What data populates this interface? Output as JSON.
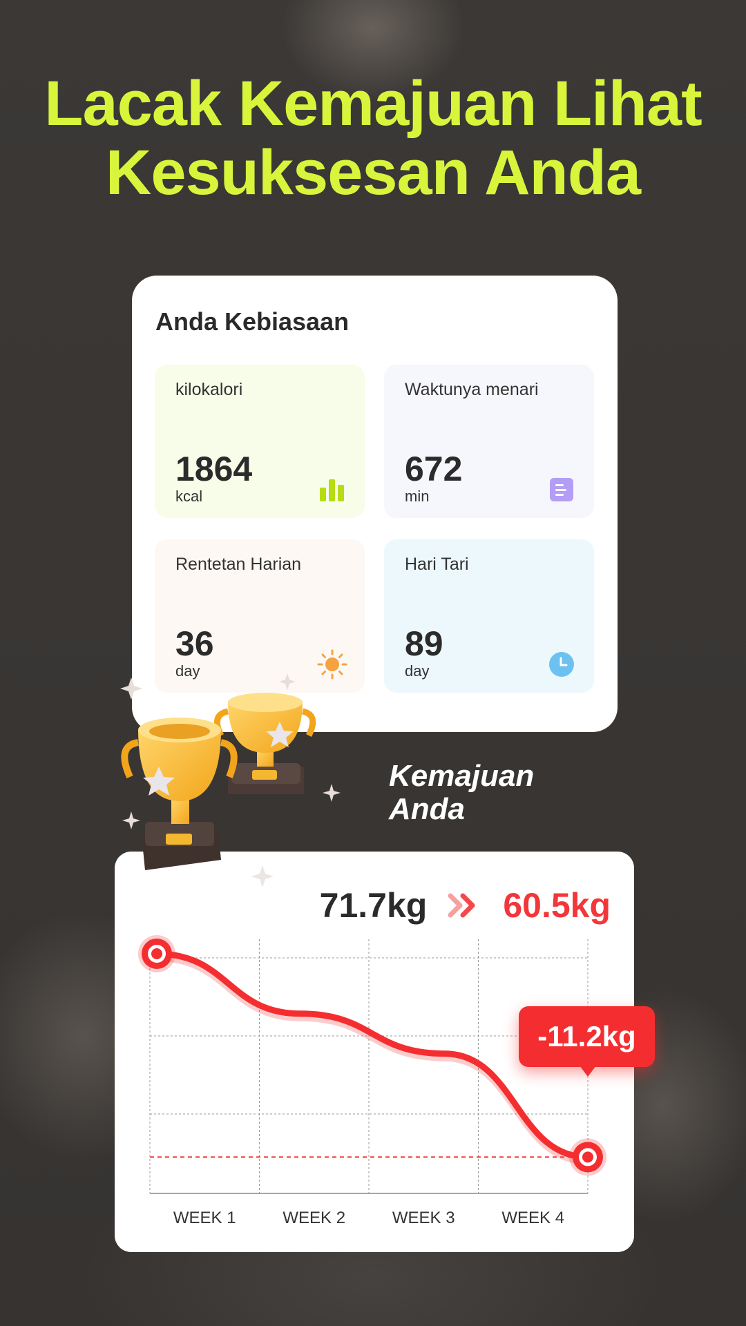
{
  "headline": {
    "line1": "Lacak Kemajuan Lihat",
    "line2": "Kesuksesan Anda"
  },
  "habits": {
    "title": "Anda Kebiasaan",
    "tiles": [
      {
        "label": "kilokalori",
        "value": "1864",
        "unit": "kcal",
        "icon": "bar-chart-icon"
      },
      {
        "label": "Waktunya menari",
        "value": "672",
        "unit": "min",
        "icon": "document-icon"
      },
      {
        "label": "Rentetan Harian",
        "value": "36",
        "unit": "day",
        "icon": "sun-icon"
      },
      {
        "label": "Hari Tari",
        "value": "89",
        "unit": "day",
        "icon": "clock-icon"
      }
    ]
  },
  "progress": {
    "title_line1": "Kemajuan",
    "title_line2": "Anda",
    "start_weight": "71.7kg",
    "end_weight": "60.5kg",
    "difference": "-11.2kg"
  },
  "colors": {
    "accent": "#d8f53b",
    "red": "#f42e30",
    "purple": "#b39df5",
    "orange": "#f5a340",
    "blue": "#6cc1f0"
  },
  "chart_data": {
    "type": "line",
    "categories": [
      "WEEK 1",
      "WEEK 2",
      "WEEK 3",
      "WEEK 4"
    ],
    "series": [
      {
        "values": [
          71.7,
          68.4,
          66.2,
          60.5
        ]
      }
    ],
    "xlabel": "",
    "ylabel": "",
    "grid": true,
    "target_line": 60.5
  }
}
